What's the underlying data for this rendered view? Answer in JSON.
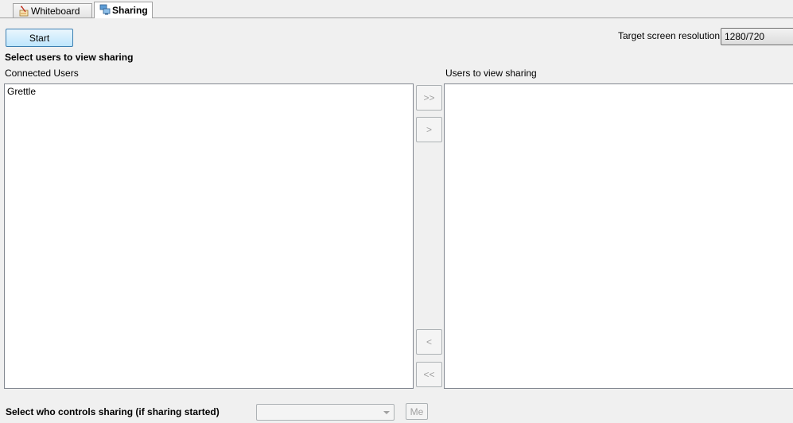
{
  "tabs": [
    {
      "label": "Whiteboard",
      "icon": "whiteboard-icon",
      "active": false
    },
    {
      "label": "Sharing",
      "icon": "screen-share-icon",
      "active": true
    }
  ],
  "toolbar": {
    "start_label": "Start",
    "target_resolution_label": "Target screen resolution",
    "target_resolution_value": "1280/720"
  },
  "selection": {
    "heading": "Select users to view sharing",
    "connected_users_label": "Connected Users",
    "connected_users": [
      "Grettle"
    ],
    "viewers_label": "Users to view sharing",
    "viewers": []
  },
  "transfer_buttons": {
    "move_all_right": ">>",
    "move_right": ">",
    "move_left": "<",
    "move_all_left": "<<"
  },
  "control": {
    "label": "Select who controls sharing (if sharing started)",
    "selected_value": "",
    "me_label": "Me"
  },
  "colors": {
    "window_bg": "#f0f0f0",
    "list_bg": "#ffffff",
    "primary_button_border": "#3c7fb1",
    "disabled_text": "#a0a0a0"
  }
}
